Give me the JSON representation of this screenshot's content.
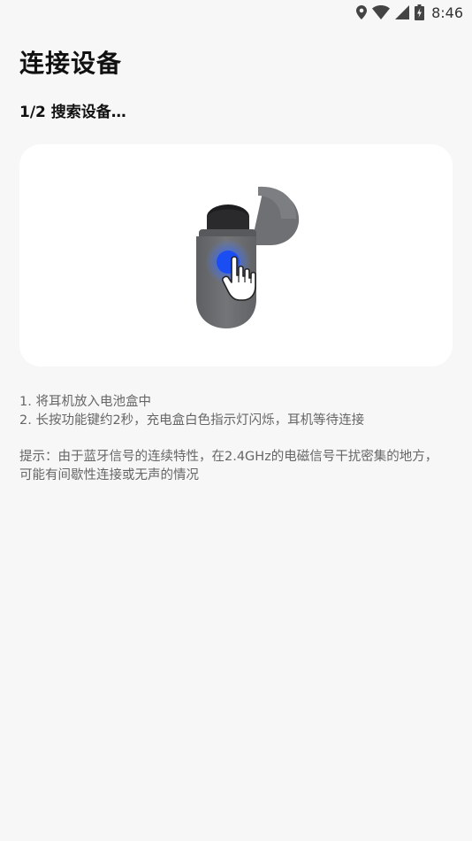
{
  "status_bar": {
    "time": "8:46",
    "icons": [
      "location-icon",
      "wifi-icon",
      "signal-icon",
      "battery-charging-icon"
    ]
  },
  "page": {
    "title": "连接设备",
    "step": "1/2 搜索设备…"
  },
  "illustration": {
    "description_icon": "earbuds-case-press-icon",
    "colors": {
      "case": "#6b6d70",
      "press_dot": "#1b4ef2",
      "press_ring": "#3f6ff5"
    }
  },
  "instructions": {
    "items": [
      "1.  将耳机放入电池盒中",
      "2. 长按功能键约2秒，充电盒白色指示灯闪烁，耳机等待连接"
    ],
    "tip": "提示：由于蓝牙信号的连续特性，在2.4GHz的电磁信号干扰密集的地方，可能有间歇性连接或无声的情况"
  }
}
